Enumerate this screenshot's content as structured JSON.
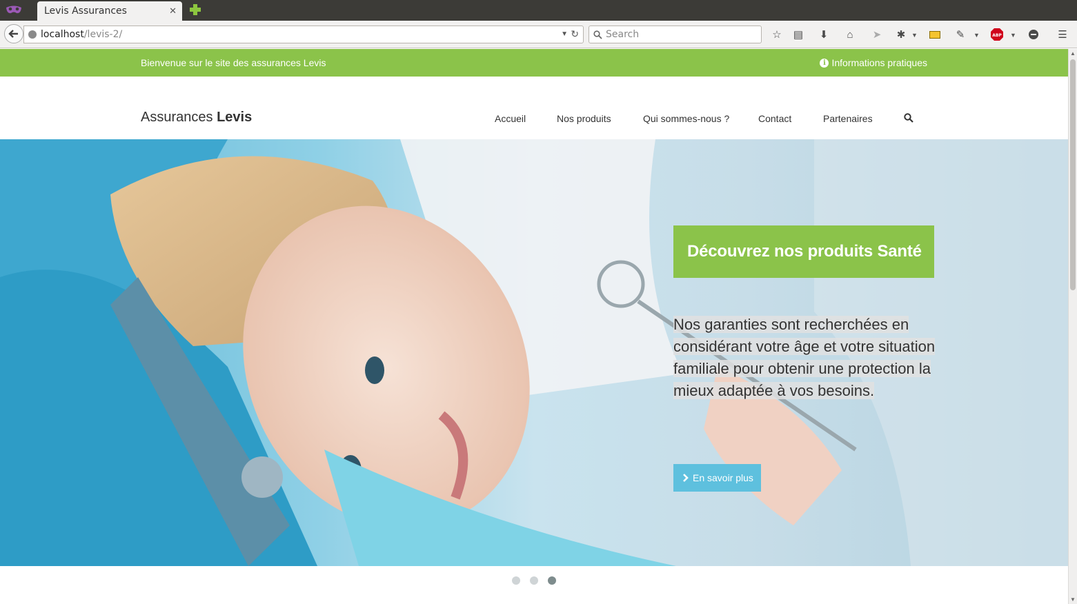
{
  "browser": {
    "tab_title": "Levis Assurances",
    "tab_close": "✕",
    "url_host": "localhost",
    "url_path": "/levis-2/",
    "search_placeholder": "Search"
  },
  "topbar": {
    "welcome": "Bienvenue sur le site des assurances Levis",
    "info_label": "Informations pratiques",
    "info_icon": "i"
  },
  "header": {
    "brand_prefix": "Assurances",
    "brand_bold": "Levis",
    "menu": [
      {
        "label": "Accueil"
      },
      {
        "label": "Nos produits"
      },
      {
        "label": "Qui sommes-nous ?"
      },
      {
        "label": "Contact"
      },
      {
        "label": "Partenaires"
      }
    ]
  },
  "hero": {
    "title": "Découvrez nos produits Santé",
    "text": "Nos garanties sont recherchées en considérant votre âge et votre situation familiale pour obtenir une protection la mieux adaptée à vos besoins.",
    "button_label": "En savoir plus"
  },
  "carousel": {
    "count": 3,
    "active_index": 2
  },
  "colors": {
    "brand_green": "#8bc34a",
    "button_blue": "#5ec0de"
  }
}
